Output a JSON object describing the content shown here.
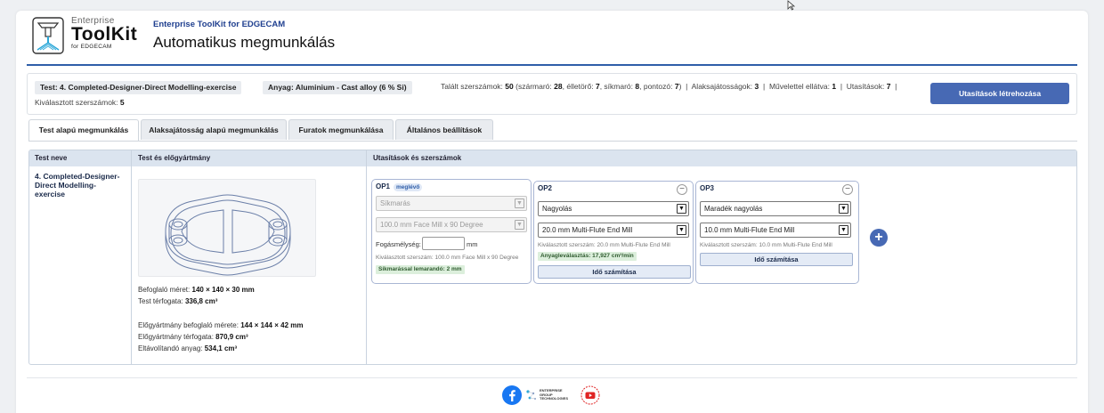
{
  "header": {
    "logo_small": "Enterprise",
    "logo_big": "ToolKit",
    "logo_sub": "for EDGECAM",
    "app_subtitle": "Enterprise ToolKit for EDGECAM",
    "app_title": "Automatikus megmunkálás"
  },
  "info": {
    "test_pill": "Test: 4. Completed-Designer-Direct Modelling-exercise",
    "material_pill": "Anyag: Aluminium - Cast alloy (6 % Si)",
    "found_tools_label": "Talált szerszámok:",
    "found_tools_value": "50",
    "open_paren": "(",
    "shank_label": "szármaró:",
    "shank_value": "28",
    "corner_label": ", élletörő:",
    "corner_value": "7",
    "face_label": ", síkmaró:",
    "face_value": "8",
    "spot_label": ", pontozó:",
    "spot_value": "7",
    "close_paren": ")",
    "sep1": "|",
    "shape_label": "Alaksajátosságok:",
    "shape_value": "3",
    "sep2": "|",
    "ops_label": "Művelettel ellátva:",
    "ops_value": "1",
    "sep3": "|",
    "instr_label": "Utasítások:",
    "instr_value": "7",
    "sep4": "|",
    "selected_tools_label": "Kiválasztott szerszámok:",
    "selected_tools_value": "5",
    "create_button": "Utasítások létrehozása"
  },
  "tabs": [
    {
      "label": "Test alapú megmunkálás"
    },
    {
      "label": "Alaksajátosság alapú megmunkálás"
    },
    {
      "label": "Furatok megmunkálása"
    },
    {
      "label": "Általános beállítások"
    }
  ],
  "table": {
    "col_name": "Test neve",
    "col_body": "Test és előgyártmány",
    "col_instructions": "Utasítások és szerszámok",
    "row_name": "4. Completed-Designer-Direct Modelling-exercise",
    "bbox_label": "Befoglaló méret:",
    "bbox_value": "140 × 140 × 30 mm",
    "volume_label": "Test térfogata:",
    "volume_value": "336,8 cm³",
    "stock_bbox_label": "Előgyártmány befoglaló mérete:",
    "stock_bbox_value": "144 × 144 × 42 mm",
    "stock_volume_label": "Előgyártmány térfogata:",
    "stock_volume_value": "870,9 cm³",
    "remove_label": "Eltávolítandó anyag:",
    "remove_value": "534,1 cm³"
  },
  "ops": {
    "op1": {
      "title": "OP1",
      "badge": "meglévő",
      "operation": "Síkmarás",
      "tool": "100.0 mm Face Mill x 90 Degree",
      "depth_label": "Fogásmélység:",
      "depth_value": "",
      "depth_unit": "mm",
      "selected_tool": "Kiválasztott szerszám: 100.0 mm Face Mill x 90 Degree",
      "info": "Síkmarással lemarandó: 2 mm"
    },
    "op2": {
      "title": "OP2",
      "remove": "−",
      "operation": "Nagyolás",
      "tool": "20.0 mm Multi-Flute End Mill",
      "selected_tool": "Kiválasztott szerszám: 20.0 mm Multi-Flute End Mill",
      "info": "Anyagleválasztás: 17,927 cm³/min",
      "time_button": "Idő számítása"
    },
    "op3": {
      "title": "OP3",
      "remove": "−",
      "operation": "Maradék nagyolás",
      "tool": "10.0 mm Multi-Flute End Mill",
      "selected_tool": "Kiválasztott szerszám: 10.0 mm Multi-Flute End Mill",
      "time_button": "Idő számítása"
    },
    "add_button": "+"
  },
  "footer": {
    "group_logo_line1": "ENTERPRISE",
    "group_logo_line2": "GROUP",
    "group_logo_line3": "TECHNOLOGIES"
  },
  "colors": {
    "accent": "#4769b4",
    "header_line": "#2f5ea9",
    "table_header": "#dbe4ef",
    "facebook": "#1877f2",
    "youtube": "#e02424"
  },
  "icons": [
    "cursor-icon",
    "toolkit-logo-icon",
    "dropdown-arrow-icon",
    "facebook-icon",
    "enterprise-group-logo",
    "youtube-icon"
  ]
}
